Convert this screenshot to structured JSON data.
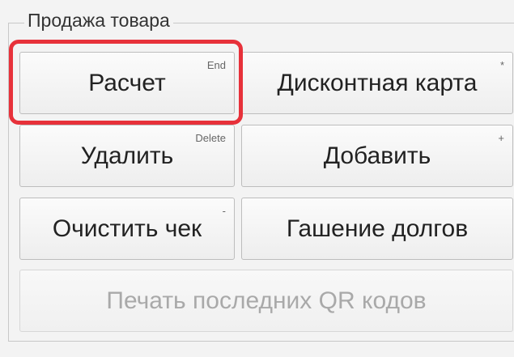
{
  "group": {
    "title": "Продажа товара"
  },
  "buttons": {
    "calc": {
      "label": "Расчет",
      "hotkey": "End"
    },
    "discount_card": {
      "label": "Дисконтная карта",
      "hotkey": "*"
    },
    "delete": {
      "label": "Удалить",
      "hotkey": "Delete"
    },
    "add": {
      "label": "Добавить",
      "hotkey": "+"
    },
    "clear_check": {
      "label": "Очистить чек",
      "hotkey": "-"
    },
    "debt_payment": {
      "label": "Гашение долгов",
      "hotkey": ""
    },
    "print_qr": {
      "label": "Печать последних QR кодов"
    }
  },
  "colors": {
    "highlight": "#e7313a",
    "disabled_text": "#a9a9a9"
  }
}
